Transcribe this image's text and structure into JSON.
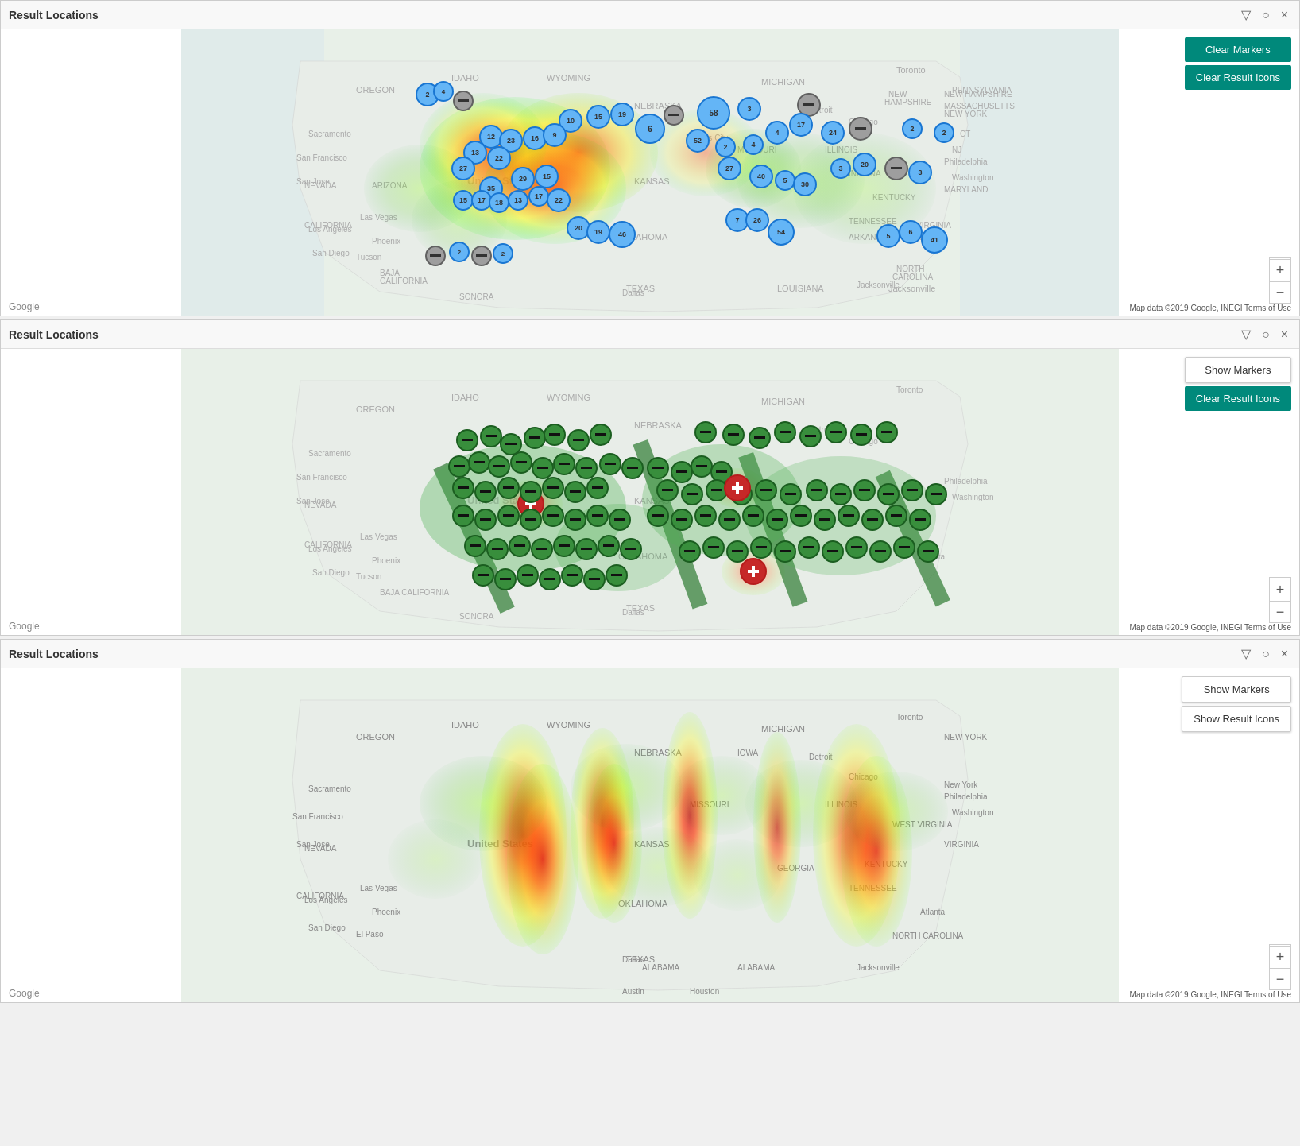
{
  "panels": [
    {
      "id": "panel1",
      "title": "Result Locations",
      "buttons": [
        {
          "label": "Clear Markers",
          "type": "teal",
          "name": "clear-markers-btn-1"
        },
        {
          "label": "Clear Result Icons",
          "type": "teal",
          "name": "clear-result-icons-btn-1"
        }
      ],
      "mapType": "heatmap-with-clusters",
      "attribution": "Map data ©2019 Google, INEGI  Terms of Use"
    },
    {
      "id": "panel2",
      "title": "Result Locations",
      "buttons": [
        {
          "label": "Show Markers",
          "type": "white",
          "name": "show-markers-btn-2"
        },
        {
          "label": "Clear Result Icons",
          "type": "teal",
          "name": "clear-result-icons-btn-2"
        }
      ],
      "mapType": "result-icons",
      "attribution": "Map data ©2019 Google, INEGI  Terms of Use"
    },
    {
      "id": "panel3",
      "title": "Result Locations",
      "buttons": [
        {
          "label": "Show Markers",
          "type": "white",
          "name": "show-markers-btn-3"
        },
        {
          "label": "Show Result Icons",
          "type": "white",
          "name": "show-result-icons-btn-3"
        }
      ],
      "mapType": "heatmap-only",
      "attribution": "Map data ©2019 Google, INEGI  Terms of Use"
    }
  ],
  "icons": {
    "minimize": "▽",
    "close": "×",
    "expand": "⤢",
    "zoom_in": "+",
    "zoom_out": "−",
    "fullscreen": "⛶"
  },
  "google_logo": "Google"
}
